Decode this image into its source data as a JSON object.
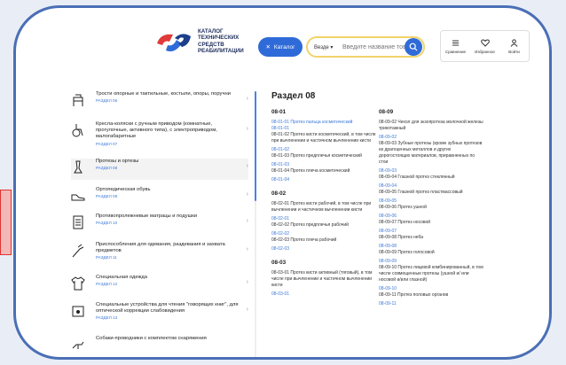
{
  "logo": {
    "line1": "КАТАЛОГ",
    "line2": "ТЕХНИЧЕСКИХ СРЕДСТВ",
    "line3": "РЕАБИЛИТАЦИИ"
  },
  "header": {
    "catalog_label": "Каталог",
    "search_scope": "Везде",
    "search_placeholder": "Введите название товара",
    "compare_label": "Сравнение",
    "favorites_label": "Избранное",
    "login_label": "Войти"
  },
  "sidebar": {
    "items": [
      {
        "title": "Трости опорные и тактильные, костыли, опоры, поручни",
        "code": "РАЗДЕЛ 06",
        "icon": "cane-icon"
      },
      {
        "title": "Кресла-коляски с ручным приводом (комнатные, прогулочные, активного типа), с электроприводом, малогабаритные",
        "code": "РАЗДЕЛ 07",
        "icon": "wheelchair-icon"
      },
      {
        "title": "Протезы и ортезы",
        "code": "РАЗДЕЛ 08",
        "icon": "prosthesis-icon"
      },
      {
        "title": "Ортопедическая обувь",
        "code": "РАЗДЕЛ 09",
        "icon": "shoe-icon"
      },
      {
        "title": "Противопролежневые матрацы и подушки",
        "code": "РАЗДЕЛ 10",
        "icon": "mattress-icon"
      },
      {
        "title": "Приспособления для одевания, раздевания и захвата предметов",
        "code": "РАЗДЕЛ 11",
        "icon": "grabber-icon"
      },
      {
        "title": "Специальная одежда",
        "code": "РАЗДЕЛ 12",
        "icon": "clothing-icon"
      },
      {
        "title": "Специальные устройства для чтения \"говорящих книг\", для оптической коррекции слабовидения",
        "code": "РАЗДЕЛ 13",
        "icon": "reader-device-icon"
      },
      {
        "title": "Собаки-проводники с комплектом снаряжения",
        "code": "",
        "icon": "guide-dog-icon"
      }
    ]
  },
  "section": {
    "title": "Раздел 08",
    "col_a": [
      {
        "group": "08-01"
      },
      {
        "code": "08-01-01 Протез пальца косметический"
      },
      {
        "code": "08-01-01",
        "text": "08-01-02 Протез кисти косметический, в том числе при вычленении и частичном вычленении кисти"
      },
      {
        "code": "08-01-02",
        "text": "08-01-03 Протез предплечья косметический"
      },
      {
        "code": "08-01-03",
        "text": "08-01-04 Протез плеча косметический"
      },
      {
        "code": "08-01-04"
      },
      {
        "group": "08-02"
      },
      {
        "text": "08-02-01 Протез кисти рабочий, в том числе при вычленении и частичном вычленении кисти"
      },
      {
        "code": "08-02-01",
        "text": "08-02-02 Протез предплечья рабочий"
      },
      {
        "code": "08-02-02",
        "text": "08-02-03 Протез плеча рабочий"
      },
      {
        "code": "08-02-03"
      },
      {
        "group": "08-03"
      },
      {
        "text": "08-03-01 Протез кисти активный (тяговый), в том числе при вычленении и частичном вычленении кисти"
      },
      {
        "code": "08-03-01"
      }
    ],
    "col_b": [
      {
        "group": "08-09"
      },
      {
        "text": "08-09-02 Чехол для экзопротеза молочной железы трикотажный"
      },
      {
        "code": "08-09-02",
        "text": "08-09-03 Зубные протезы (кроме зубных протезов из драгоценных металлов и других дорогостоящих материалов, приравненных по стои"
      },
      {
        "code": "08-09-03",
        "text": "08-09-04 Глазной протез стеклянный"
      },
      {
        "code": "08-09-04",
        "text": "08-09-05 Глазной протез пластмассовый"
      },
      {
        "code": "08-09-05",
        "text": "08-09-06 Протез ушной"
      },
      {
        "code": "08-09-06",
        "text": "08-09-07 Протез носовой"
      },
      {
        "code": "08-09-07",
        "text": "08-09-08 Протез неба"
      },
      {
        "code": "08-09-08",
        "text": "08-09-09 Протез голосовой"
      },
      {
        "code": "08-09-09",
        "text": "08-09-10 Протез лицевой комбинированный, в том числе совмещенные протезы (ушной и/ или носовой и/или глазной)"
      },
      {
        "code": "08-09-10",
        "text": "08-09-11 Протез половых органов"
      },
      {
        "code": "08-09-11"
      }
    ]
  },
  "colors": {
    "accent": "#2f6bd8",
    "link": "#3b78d8",
    "frame": "#4a6fb5",
    "search_border": "#f1d36a"
  }
}
